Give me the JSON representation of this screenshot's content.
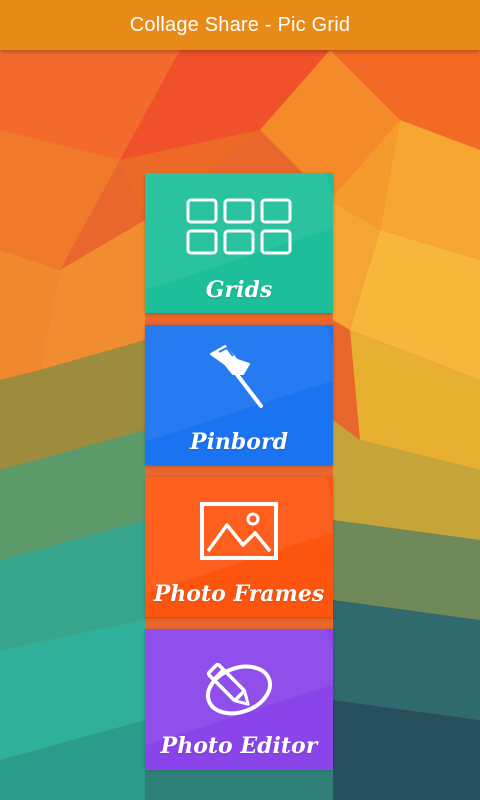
{
  "app": {
    "title": "Collage Share - Pic Grid"
  },
  "menu": {
    "items": [
      {
        "label": "Grids",
        "icon": "grid-icon",
        "color": "#1dbf9a"
      },
      {
        "label": "Pinbord",
        "icon": "pushpin-icon",
        "color": "#1a73f0"
      },
      {
        "label": "Photo Frames",
        "icon": "picture-icon",
        "color": "#fc5510"
      },
      {
        "label": "Photo Editor",
        "icon": "edit-pencil-icon",
        "color": "#8a45ea"
      }
    ]
  },
  "colors": {
    "titlebar": "#e88a18",
    "background_top": "#f0552a",
    "background_bottom": "#2a7f7a"
  }
}
